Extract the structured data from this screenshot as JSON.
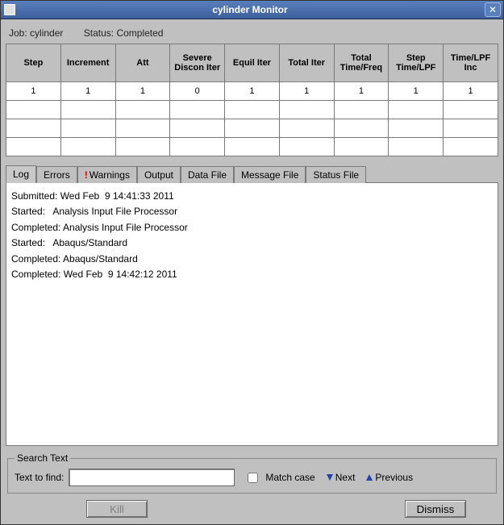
{
  "window": {
    "title": "cylinder Monitor"
  },
  "status": {
    "job_label": "Job:",
    "job_value": "cylinder",
    "status_label": "Status:",
    "status_value": "Completed"
  },
  "grid": {
    "columns": [
      "Step",
      "Increment",
      "Att",
      "Severe Discon Iter",
      "Equil Iter",
      "Total Iter",
      "Total Time/Freq",
      "Step Time/LPF",
      "Time/LPF Inc"
    ],
    "rows": [
      [
        "1",
        "1",
        "1",
        "0",
        "1",
        "1",
        "1",
        "1",
        "1"
      ],
      [
        "",
        "",
        "",
        "",
        "",
        "",
        "",
        "",
        ""
      ],
      [
        "",
        "",
        "",
        "",
        "",
        "",
        "",
        "",
        ""
      ],
      [
        "",
        "",
        "",
        "",
        "",
        "",
        "",
        "",
        ""
      ]
    ]
  },
  "tabs": {
    "items": [
      {
        "label": "Log",
        "warn": false,
        "active": true
      },
      {
        "label": "Errors",
        "warn": false,
        "active": false
      },
      {
        "label": "Warnings",
        "warn": true,
        "active": false
      },
      {
        "label": "Output",
        "warn": false,
        "active": false
      },
      {
        "label": "Data File",
        "warn": false,
        "active": false
      },
      {
        "label": "Message File",
        "warn": false,
        "active": false
      },
      {
        "label": "Status File",
        "warn": false,
        "active": false
      }
    ]
  },
  "log": {
    "lines": [
      "Submitted: Wed Feb  9 14:41:33 2011",
      "",
      "Started:   Analysis Input File Processor",
      "",
      "Completed: Analysis Input File Processor",
      "",
      "Started:   Abaqus/Standard",
      "",
      "Completed: Abaqus/Standard",
      "",
      "Completed: Wed Feb  9 14:42:12 2011"
    ]
  },
  "search": {
    "legend": "Search Text",
    "find_label": "Text to find:",
    "find_value": "",
    "match_case_label": "Match case",
    "next_label": "Next",
    "prev_label": "Previous"
  },
  "buttons": {
    "kill": "Kill",
    "dismiss": "Dismiss"
  }
}
